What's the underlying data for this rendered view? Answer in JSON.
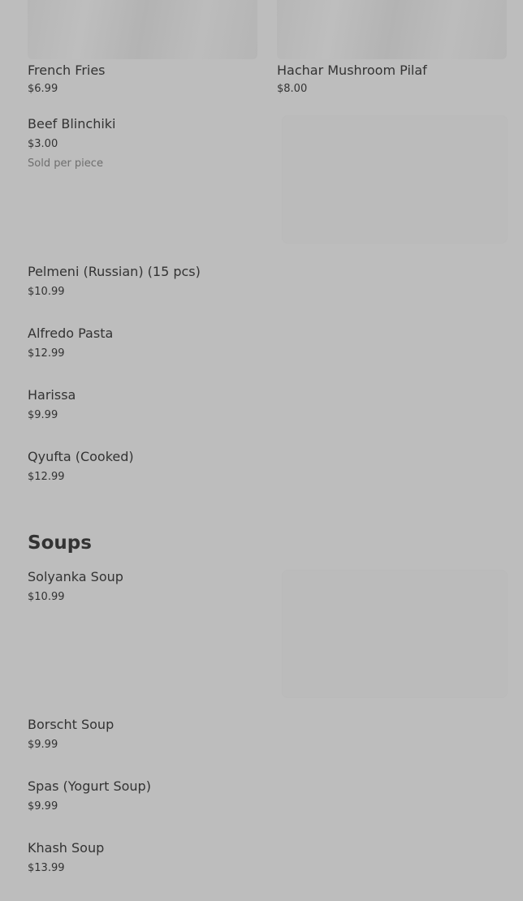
{
  "grid_items": [
    {
      "name": "French Fries",
      "price": "$6.99"
    },
    {
      "name": "Hachar Mushroom Pilaf",
      "price": "$8.00"
    }
  ],
  "items": [
    {
      "name": "Beef Blinchiki",
      "price": "$3.00",
      "note": "Sold per piece"
    },
    {
      "name": "Pelmeni (Russian) (15 pcs)",
      "price": "$10.99"
    },
    {
      "name": "Alfredo Pasta",
      "price": "$12.99"
    },
    {
      "name": "Harissa",
      "price": "$9.99"
    },
    {
      "name": "Qyufta (Cooked)",
      "price": "$12.99"
    }
  ],
  "soups": {
    "title": "Soups",
    "items": [
      {
        "name": "Solyanka Soup",
        "price": "$10.99"
      },
      {
        "name": "Borscht Soup",
        "price": "$9.99"
      },
      {
        "name": "Spas (Yogurt Soup)",
        "price": "$9.99"
      },
      {
        "name": "Khash Soup",
        "price": "$13.99"
      }
    ]
  }
}
